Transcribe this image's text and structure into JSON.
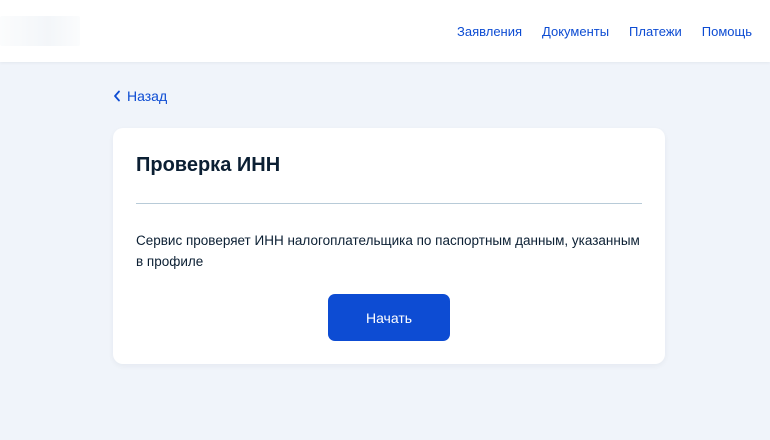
{
  "header": {
    "nav": [
      {
        "label": "Заявления"
      },
      {
        "label": "Документы"
      },
      {
        "label": "Платежи"
      },
      {
        "label": "Помощь"
      }
    ]
  },
  "back_link": {
    "label": "Назад"
  },
  "card": {
    "title": "Проверка ИНН",
    "description": "Сервис проверяет ИНН налогоплательщика по паспортным данным, указанным в профиле",
    "start_button_label": "Начать"
  },
  "colors": {
    "accent": "#0d4cd3",
    "background": "#f0f4fa",
    "card": "#ffffff",
    "text": "#0b1f33",
    "divider": "#b8cbd8"
  },
  "icons": {
    "back": "chevron-left-icon"
  }
}
